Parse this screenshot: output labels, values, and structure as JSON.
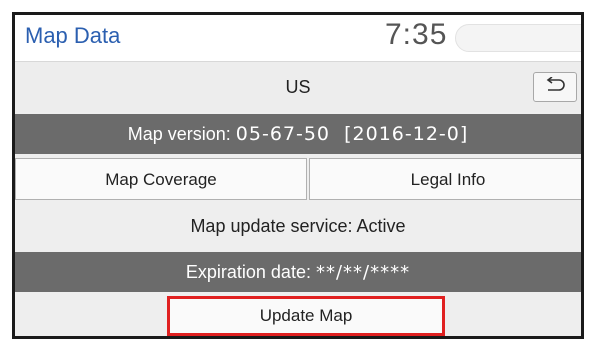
{
  "header": {
    "title": "Map Data",
    "time": "7:35"
  },
  "region": {
    "label": "US",
    "back_icon": "back-arrow-icon"
  },
  "map_version": {
    "label": "Map version:",
    "value": "05-67-50  [2016-12-0]"
  },
  "buttons": {
    "coverage": "Map Coverage",
    "legal": "Legal Info",
    "update": "Update Map"
  },
  "service": {
    "status": "Map update service: Active"
  },
  "expiration": {
    "label": "Expiration date:",
    "value": "**/**/****"
  },
  "colors": {
    "title": "#2b5fb0",
    "bar": "#6b6b6b",
    "highlight": "#e02020"
  }
}
